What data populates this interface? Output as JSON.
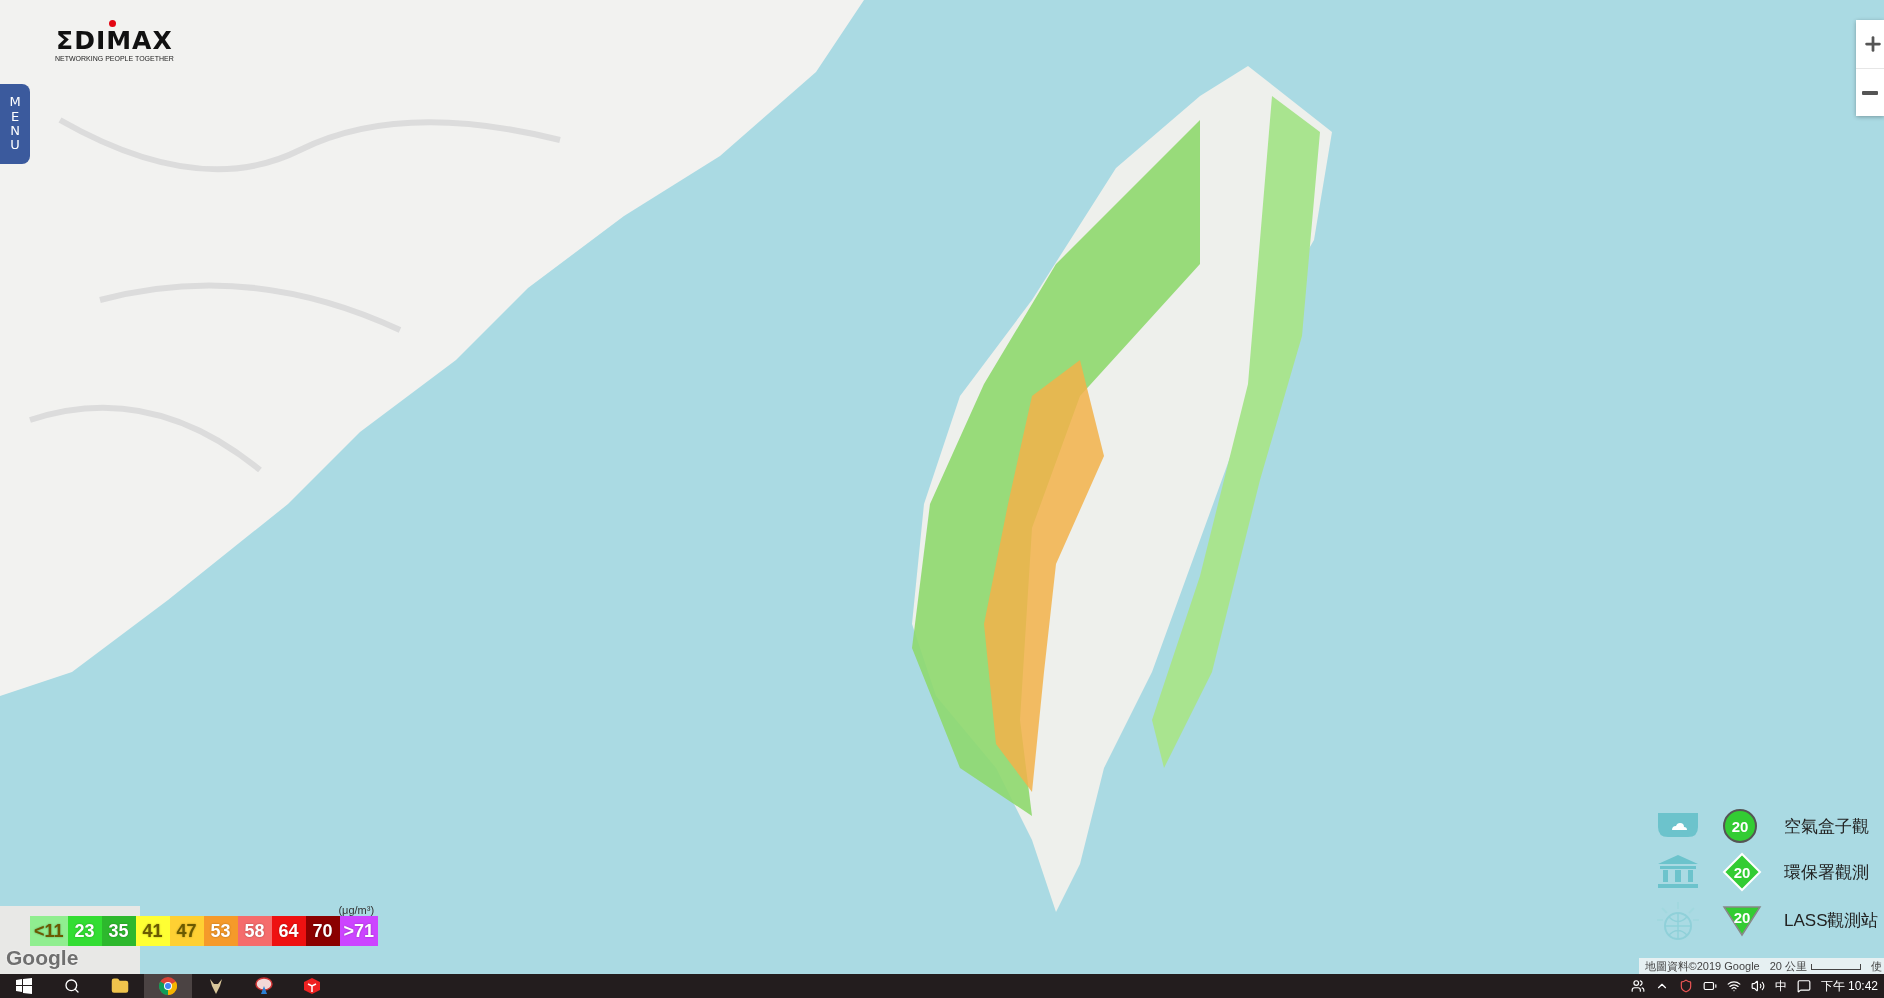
{
  "logo": {
    "name": "ΣDIMAX",
    "tagline": "NETWORKING PEOPLE TOGETHER"
  },
  "menu_tab": {
    "label": "MENU"
  },
  "zoom_controls": [
    {
      "kind": "in"
    },
    {
      "kind": "out"
    }
  ],
  "pm_legend": {
    "unit": "(μg/m³)",
    "steps": [
      {
        "label": "<11",
        "color": "#90ee90"
      },
      {
        "label": "23",
        "color": "#33dd33"
      },
      {
        "label": "35",
        "color": "#2db82d"
      },
      {
        "label": "41",
        "color": "#ffff33"
      },
      {
        "label": "47",
        "color": "#ffd033"
      },
      {
        "label": "53",
        "color": "#f59a2a"
      },
      {
        "label": "58",
        "color": "#f56c6c"
      },
      {
        "label": "64",
        "color": "#ee1111"
      },
      {
        "label": "70",
        "color": "#8b0000"
      },
      {
        "label": ">71",
        "color": "#cc44ff"
      }
    ]
  },
  "google_mark": "Google",
  "station_legend": [
    {
      "kind": "airbox",
      "value": "20",
      "label": "空氣盒子觀"
    },
    {
      "kind": "epa",
      "value": "20",
      "label": "環保署觀測"
    },
    {
      "kind": "lass",
      "value": "20",
      "label": "LASS觀測站"
    }
  ],
  "attribution": {
    "data": "地圖資料©2019 Google",
    "scale": "20 公里",
    "terms": "使"
  },
  "taskbar": {
    "apps": [
      {
        "kind": "windows",
        "selected": false
      },
      {
        "kind": "search",
        "selected": false
      },
      {
        "kind": "folder",
        "selected": false
      },
      {
        "kind": "chrome",
        "selected": true
      },
      {
        "kind": "goat",
        "selected": false
      },
      {
        "kind": "satellite",
        "selected": false
      },
      {
        "kind": "sketchup",
        "selected": false
      }
    ],
    "ime": "中",
    "time": "下午 10:42"
  }
}
